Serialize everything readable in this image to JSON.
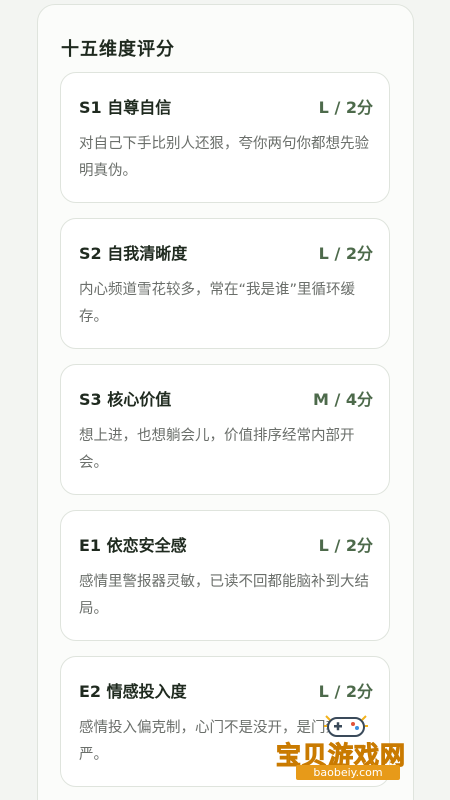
{
  "section": {
    "title": "十五维度评分"
  },
  "cards": [
    {
      "title": "S1 自尊自信",
      "score": "L / 2分",
      "desc": "对自己下手比别人还狠，夸你两句你都想先验明真伪。"
    },
    {
      "title": "S2 自我清晰度",
      "score": "L / 2分",
      "desc": "内心频道雪花较多，常在“我是谁”里循环缓存。"
    },
    {
      "title": "S3 核心价值",
      "score": "M / 4分",
      "desc": "想上进，也想躺会儿，价值排序经常内部开会。"
    },
    {
      "title": "E1 依恋安全感",
      "score": "L / 2分",
      "desc": "感情里警报器灵敏，已读不回都能脑补到大结局。"
    },
    {
      "title": "E2 情感投入度",
      "score": "L / 2分",
      "desc": "感情投入偏克制，心门不是没开，是门禁太严。"
    }
  ],
  "watermark": {
    "name": "宝贝游戏网",
    "url": "baobeiy.com",
    "icon": "gamepad-icon"
  },
  "colors": {
    "score": "#4d6a4b",
    "title": "#1f2a1f",
    "desc": "#6b6f6b",
    "watermark": "#f2b21c"
  }
}
